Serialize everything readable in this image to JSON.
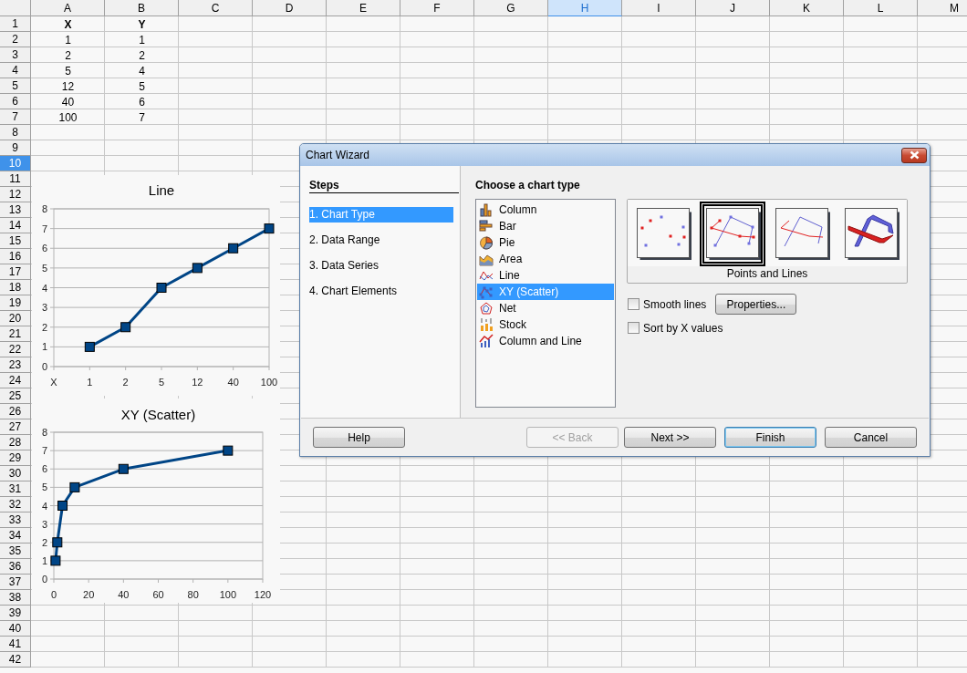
{
  "sheet": {
    "columns": [
      {
        "label": "A",
        "selected": false
      },
      {
        "label": "B",
        "selected": false
      },
      {
        "label": "C",
        "selected": false
      },
      {
        "label": "D",
        "selected": false
      },
      {
        "label": "E",
        "selected": false
      },
      {
        "label": "F",
        "selected": false
      },
      {
        "label": "G",
        "selected": false
      },
      {
        "label": "H",
        "selected": true
      },
      {
        "label": "I",
        "selected": false
      },
      {
        "label": "J",
        "selected": false
      },
      {
        "label": "K",
        "selected": false
      },
      {
        "label": "L",
        "selected": false
      },
      {
        "label": "M",
        "selected": false
      }
    ],
    "rows": [
      {
        "label": "1",
        "selected": false,
        "cells": [
          {
            "text": "X",
            "bold": true
          },
          {
            "text": "Y",
            "bold": true
          }
        ]
      },
      {
        "label": "2",
        "selected": false,
        "cells": [
          {
            "text": "1",
            "bold": false
          },
          {
            "text": "1",
            "bold": false
          }
        ]
      },
      {
        "label": "3",
        "selected": false,
        "cells": [
          {
            "text": "2",
            "bold": false
          },
          {
            "text": "2",
            "bold": false
          }
        ]
      },
      {
        "label": "4",
        "selected": false,
        "cells": [
          {
            "text": "5",
            "bold": false
          },
          {
            "text": "4",
            "bold": false
          }
        ]
      },
      {
        "label": "5",
        "selected": false,
        "cells": [
          {
            "text": "12",
            "bold": false
          },
          {
            "text": "5",
            "bold": false
          }
        ]
      },
      {
        "label": "6",
        "selected": false,
        "cells": [
          {
            "text": "40",
            "bold": false
          },
          {
            "text": "6",
            "bold": false
          }
        ]
      },
      {
        "label": "7",
        "selected": false,
        "cells": [
          {
            "text": "100",
            "bold": false
          },
          {
            "text": "7",
            "bold": false
          }
        ]
      },
      {
        "label": "8",
        "selected": false
      },
      {
        "label": "9",
        "selected": false
      },
      {
        "label": "10",
        "selected": true
      },
      {
        "label": "11",
        "selected": false
      },
      {
        "label": "12",
        "selected": false
      },
      {
        "label": "13",
        "selected": false
      },
      {
        "label": "14",
        "selected": false
      },
      {
        "label": "15",
        "selected": false
      },
      {
        "label": "16",
        "selected": false
      },
      {
        "label": "17",
        "selected": false
      },
      {
        "label": "18",
        "selected": false
      },
      {
        "label": "19",
        "selected": false
      },
      {
        "label": "20",
        "selected": false
      },
      {
        "label": "21",
        "selected": false
      },
      {
        "label": "22",
        "selected": false
      },
      {
        "label": "23",
        "selected": false
      },
      {
        "label": "24",
        "selected": false
      },
      {
        "label": "25",
        "selected": false
      },
      {
        "label": "26",
        "selected": false
      },
      {
        "label": "27",
        "selected": false
      },
      {
        "label": "28",
        "selected": false
      },
      {
        "label": "29",
        "selected": false
      },
      {
        "label": "30",
        "selected": false
      },
      {
        "label": "31",
        "selected": false
      },
      {
        "label": "32",
        "selected": false
      },
      {
        "label": "33",
        "selected": false
      },
      {
        "label": "34",
        "selected": false
      },
      {
        "label": "35",
        "selected": false
      },
      {
        "label": "36",
        "selected": false
      },
      {
        "label": "37",
        "selected": false
      },
      {
        "label": "38",
        "selected": false
      },
      {
        "label": "39",
        "selected": false
      },
      {
        "label": "40",
        "selected": false
      },
      {
        "label": "41",
        "selected": false
      },
      {
        "label": "42",
        "selected": false
      }
    ]
  },
  "charts": [
    {
      "chart_data": {
        "type": "line",
        "title": "Line",
        "categories": [
          "X",
          "1",
          "2",
          "5",
          "12",
          "40",
          "100"
        ],
        "series": [
          {
            "color": "#004586",
            "marker": "square",
            "values": [
              null,
              1,
              2,
              4,
              5,
              6,
              7
            ]
          }
        ],
        "grid": true,
        "ylim": [
          0,
          8
        ],
        "yticks": [
          0,
          1,
          2,
          3,
          4,
          5,
          6,
          7,
          8
        ]
      }
    },
    {
      "chart_data": {
        "type": "line",
        "title": "XY (Scatter)",
        "x": [
          1,
          2,
          5,
          12,
          40,
          100
        ],
        "series": [
          {
            "color": "#004586",
            "marker": "square",
            "values": [
              1,
              2,
              4,
              5,
              6,
              7
            ]
          }
        ],
        "grid": true,
        "xlim": [
          0,
          120
        ],
        "ylim": [
          0,
          8
        ],
        "xticks": [
          0,
          20,
          40,
          60,
          80,
          100,
          120
        ],
        "yticks": [
          0,
          1,
          2,
          3,
          4,
          5,
          6,
          7,
          8
        ]
      }
    }
  ],
  "dialog": {
    "title": "Chart Wizard",
    "steps_heading": "Steps",
    "steps": [
      {
        "label": "1. Chart Type",
        "selected": true
      },
      {
        "label": "2. Data Range",
        "selected": false
      },
      {
        "label": "3. Data Series",
        "selected": false
      },
      {
        "label": "4. Chart Elements",
        "selected": false
      }
    ],
    "chart_type_heading": "Choose a chart type",
    "chart_types": [
      {
        "kind": "column",
        "label": "Column",
        "selected": false
      },
      {
        "kind": "bar",
        "label": "Bar",
        "selected": false
      },
      {
        "kind": "pie",
        "label": "Pie",
        "selected": false
      },
      {
        "kind": "area",
        "label": "Area",
        "selected": false
      },
      {
        "kind": "line",
        "label": "Line",
        "selected": false
      },
      {
        "kind": "scatter",
        "label": "XY (Scatter)",
        "selected": true
      },
      {
        "kind": "net",
        "label": "Net",
        "selected": false
      },
      {
        "kind": "stock",
        "label": "Stock",
        "selected": false
      },
      {
        "kind": "column-line",
        "label": "Column and Line",
        "selected": false
      }
    ],
    "variants": [
      {
        "kind": "points",
        "selected": false
      },
      {
        "kind": "points-lines",
        "selected": true
      },
      {
        "kind": "lines",
        "selected": false
      },
      {
        "kind": "lines-3d",
        "selected": false
      }
    ],
    "variant_label": "Points and Lines",
    "options": [
      {
        "label": "Smooth lines",
        "checked": false
      },
      {
        "label": "Sort by X values",
        "checked": false
      }
    ],
    "properties_button": "Properties...",
    "buttons": [
      {
        "label": "Help",
        "disabled": false,
        "default": false
      },
      {
        "label": "<< Back",
        "disabled": true,
        "default": false
      },
      {
        "label": "Next >>",
        "disabled": false,
        "default": false
      },
      {
        "label": "Finish",
        "disabled": false,
        "default": true
      },
      {
        "label": "Cancel",
        "disabled": false,
        "default": false
      }
    ]
  }
}
